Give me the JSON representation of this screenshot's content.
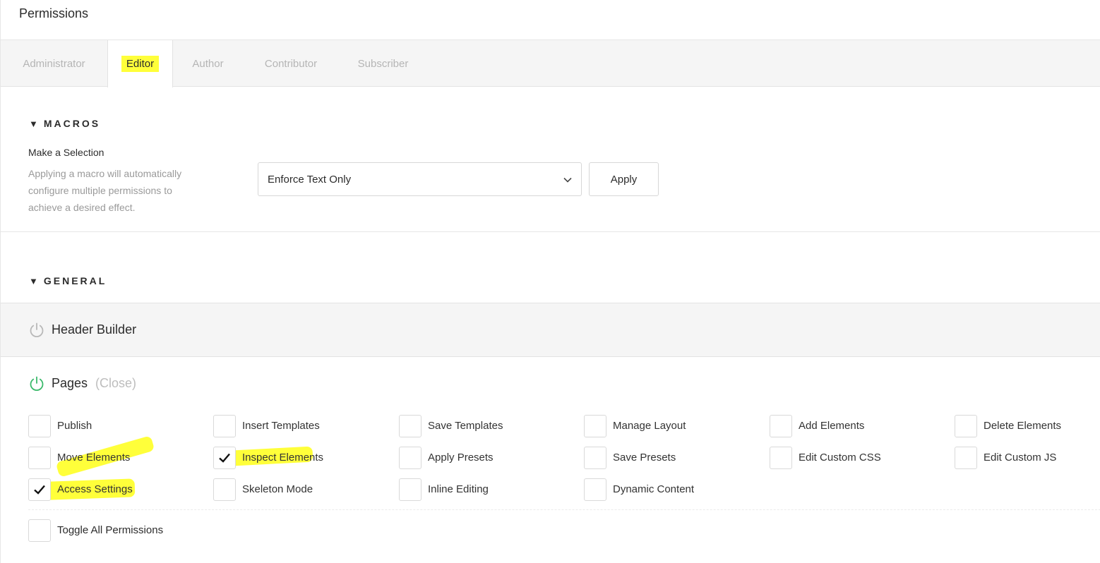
{
  "header": {
    "title": "Permissions"
  },
  "tabs": [
    {
      "label": "Administrator",
      "active": false
    },
    {
      "label": "Editor",
      "active": true
    },
    {
      "label": "Author",
      "active": false
    },
    {
      "label": "Contributor",
      "active": false
    },
    {
      "label": "Subscriber",
      "active": false
    }
  ],
  "macros": {
    "heading": "MACROS",
    "label": "Make a Selection",
    "description": "Applying a macro will automatically configure multiple permissions to achieve a desired effect.",
    "selected_value": "Enforce Text Only",
    "apply_label": "Apply"
  },
  "general": {
    "heading": "GENERAL",
    "header_builder_label": "Header Builder",
    "pages_label": "Pages",
    "pages_close_label": "(Close)",
    "permissions": [
      {
        "label": "Publish",
        "checked": false
      },
      {
        "label": "Insert Templates",
        "checked": false
      },
      {
        "label": "Save Templates",
        "checked": false
      },
      {
        "label": "Manage Layout",
        "checked": false
      },
      {
        "label": "Add Elements",
        "checked": false
      },
      {
        "label": "Delete Elements",
        "checked": false
      },
      {
        "label": "Move Elements",
        "checked": false
      },
      {
        "label": "Inspect Elements",
        "checked": true
      },
      {
        "label": "Apply Presets",
        "checked": false
      },
      {
        "label": "Save Presets",
        "checked": false
      },
      {
        "label": "Edit Custom CSS",
        "checked": false
      },
      {
        "label": "Edit Custom JS",
        "checked": false
      },
      {
        "label": "Access Settings",
        "checked": true
      },
      {
        "label": "Skeleton Mode",
        "checked": false
      },
      {
        "label": "Inline Editing",
        "checked": false
      },
      {
        "label": "Dynamic Content",
        "checked": false
      }
    ],
    "toggle_all_label": "Toggle All Permissions"
  },
  "colors": {
    "highlight": "#ffff3a",
    "power_on": "#3bb96b",
    "power_off": "#b8b8b8"
  }
}
